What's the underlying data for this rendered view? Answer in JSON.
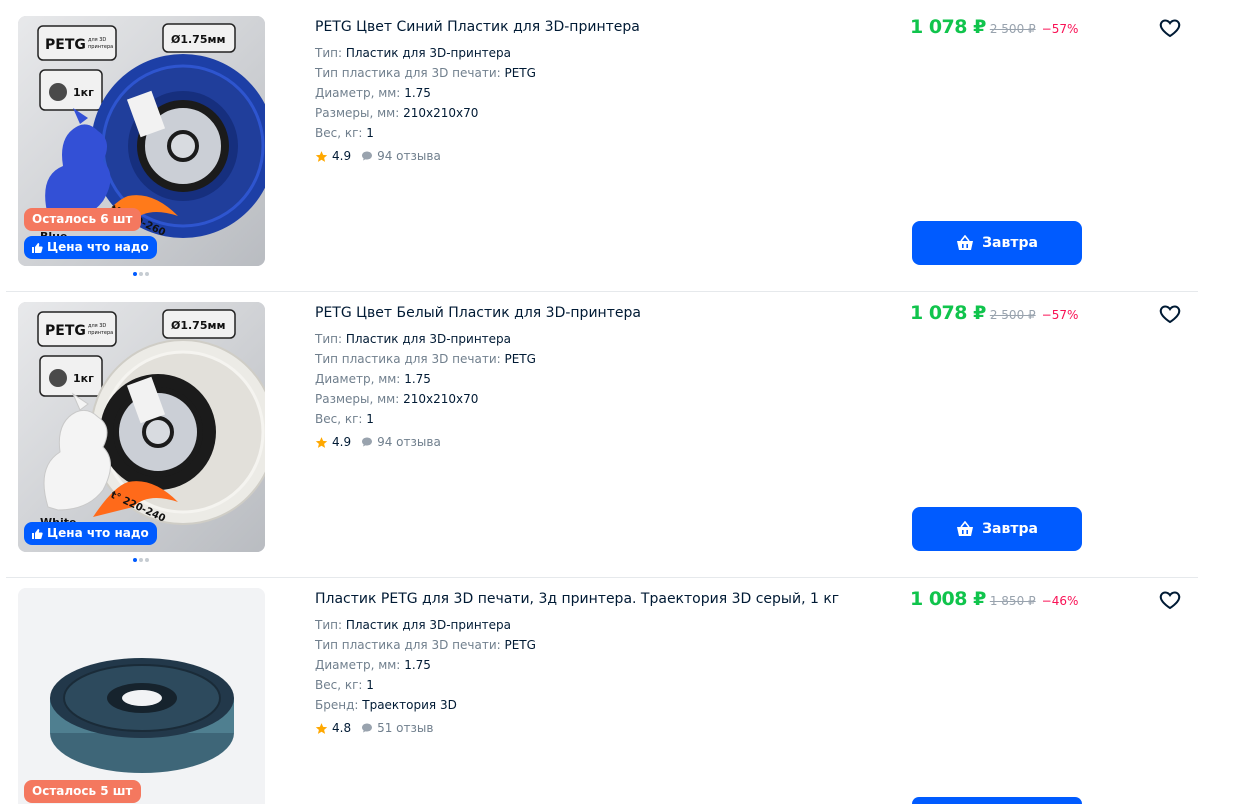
{
  "products": [
    {
      "title": "PETG Цвет Синий Пластик для 3D-принтера",
      "specs": [
        {
          "k": "Тип:",
          "v": "Пластик для 3D-принтера"
        },
        {
          "k": "Тип пластика для 3D печати:",
          "v": "PETG"
        },
        {
          "k": "Диаметр, мм:",
          "v": "1.75"
        },
        {
          "k": "Размеры, мм:",
          "v": "210x210x70"
        },
        {
          "k": "Вес, кг:",
          "v": "1"
        }
      ],
      "rating": "4.9",
      "reviews": "94 отзыва",
      "price": "1 078 ₽",
      "old_price": "2 500 ₽",
      "discount": "−57%",
      "stock_badge": "Осталось 6 шт",
      "price_badge": "Цена что надо",
      "cart_label": "Завтра",
      "image": {
        "label": "PETG",
        "label_small": "для 3D принтера",
        "diameter": "Ø1.75мм",
        "weight": "1кг",
        "temp": "t° 220-260",
        "color_word": "Blue",
        "spool_color": "#1d3fa6"
      }
    },
    {
      "title": "PETG Цвет Белый Пластик для 3D-принтера",
      "specs": [
        {
          "k": "Тип:",
          "v": "Пластик для 3D-принтера"
        },
        {
          "k": "Тип пластика для 3D печати:",
          "v": "PETG"
        },
        {
          "k": "Диаметр, мм:",
          "v": "1.75"
        },
        {
          "k": "Размеры, мм:",
          "v": "210x210x70"
        },
        {
          "k": "Вес, кг:",
          "v": "1"
        }
      ],
      "rating": "4.9",
      "reviews": "94 отзыва",
      "price": "1 078 ₽",
      "old_price": "2 500 ₽",
      "discount": "−57%",
      "price_badge": "Цена что надо",
      "cart_label": "Завтра",
      "image": {
        "label": "PETG",
        "label_small": "для 3D принтера",
        "diameter": "Ø1.75мм",
        "weight": "1кг",
        "temp": "t° 220-240",
        "color_word": "White",
        "spool_color": "#ecebe6"
      }
    },
    {
      "title": "Пластик PETG для 3D печати, 3д принтера. Траектория 3D серый, 1 кг",
      "specs": [
        {
          "k": "Тип:",
          "v": "Пластик для 3D-принтера"
        },
        {
          "k": "Тип пластика для 3D печати:",
          "v": "PETG"
        },
        {
          "k": "Диаметр, мм:",
          "v": "1.75"
        },
        {
          "k": "Вес, кг:",
          "v": "1"
        },
        {
          "k": "Бренд:",
          "v": "Траектория 3D"
        }
      ],
      "rating": "4.8",
      "reviews": "51 отзыв",
      "price": "1 008 ₽",
      "old_price": "1 850 ₽",
      "discount": "−46%",
      "stock_badge": "Осталось 5 шт"
    }
  ],
  "colors": {
    "accent": "#005bff",
    "price": "#10c44c",
    "discount": "#f91155",
    "stock": "#f4785f",
    "star": "#ffa800"
  }
}
